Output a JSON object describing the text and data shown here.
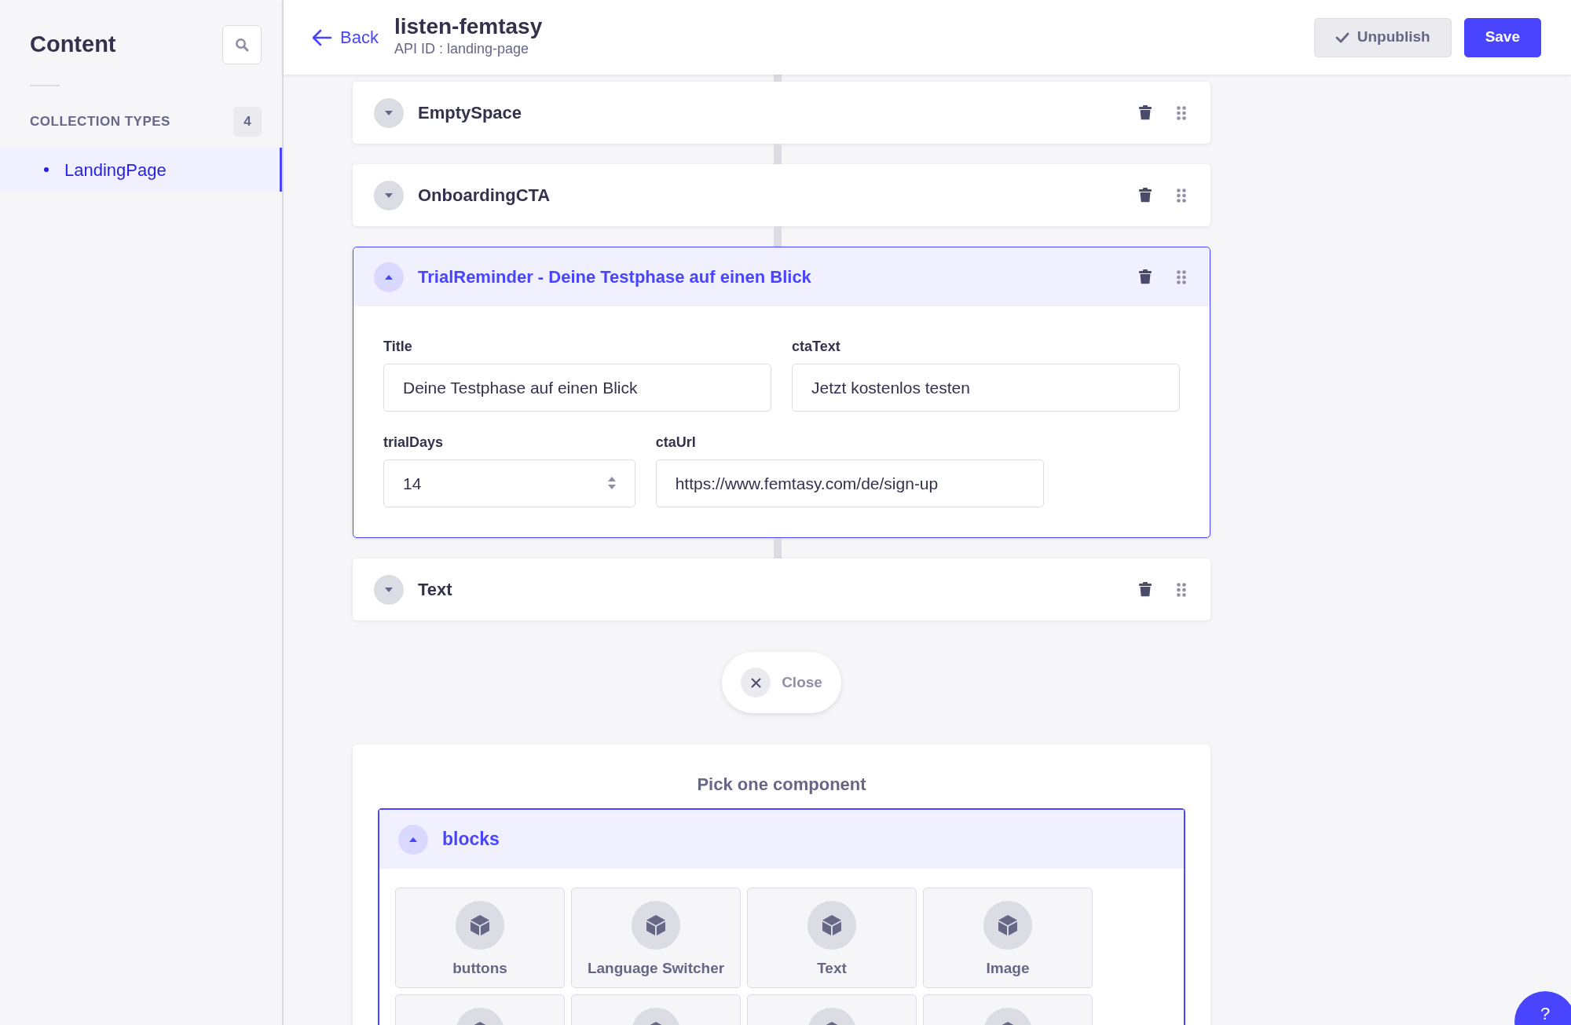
{
  "sidebar": {
    "title": "Content",
    "section": {
      "label": "COLLECTION TYPES",
      "count": "4"
    },
    "items": [
      {
        "label": "LandingPage",
        "selected": true
      }
    ]
  },
  "header": {
    "back": "Back",
    "title": "listen-femtasy",
    "subtitle": "API ID : landing-page",
    "buttons": [
      {
        "label": "Unpublish",
        "kind": "secondary"
      },
      {
        "label": "Save",
        "kind": "primary"
      }
    ]
  },
  "blocks": [
    {
      "title": "EmptySpace",
      "expanded": false
    },
    {
      "title": "OnboardingCTA",
      "expanded": false
    },
    {
      "title": "TrialReminder - Deine Testphase auf einen Blick",
      "expanded": true,
      "field_rows": [
        [
          {
            "label": "Title",
            "kind": "text",
            "value": "Deine Testphase auf einen Blick"
          },
          {
            "label": "ctaText",
            "kind": "text",
            "value": "Jetzt kostenlos testen"
          }
        ],
        [
          {
            "label": "trialDays",
            "kind": "number",
            "value": "14"
          },
          {
            "label": "ctaUrl",
            "kind": "text",
            "value": "https://www.femtasy.com/de/sign-up"
          }
        ]
      ]
    },
    {
      "title": "Text",
      "expanded": false
    }
  ],
  "close_button": "Close",
  "picker": {
    "title": "Pick one component",
    "group": {
      "name": "blocks",
      "expanded": true,
      "components": [
        {
          "kind": "tile",
          "label": "buttons"
        },
        {
          "kind": "tile",
          "label": "Language Switcher"
        },
        {
          "kind": "tile",
          "label": "Text"
        },
        {
          "kind": "tile",
          "label": "Image"
        },
        {
          "kind": "cut"
        },
        {
          "kind": "cut"
        },
        {
          "kind": "cut"
        },
        {
          "kind": "cut"
        }
      ]
    }
  },
  "help_button": "?"
}
